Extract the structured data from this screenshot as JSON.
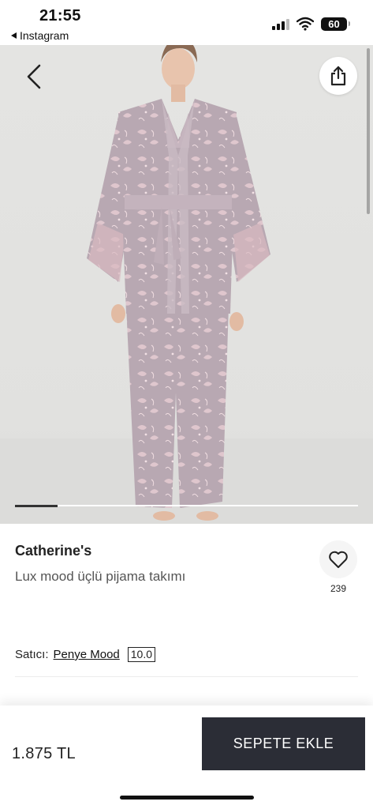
{
  "status_bar": {
    "time": "21:55",
    "back_app": "Instagram",
    "battery": "60",
    "icons": [
      "signal-icon",
      "wifi-icon",
      "battery-icon"
    ]
  },
  "product": {
    "brand": "Catherine's",
    "name": "Lux mood üçlü pijama takımı",
    "favorite_count": "239",
    "image_count_position": {
      "current": 1,
      "indicator_fraction": 0.125
    }
  },
  "seller": {
    "label": "Satıcı:",
    "name": "Penye Mood",
    "score": "10.0"
  },
  "bottom_bar": {
    "price": "1.875 TL",
    "add_to_cart": "SEPETE EKLE"
  },
  "colors": {
    "cart_button": "#2b2d36",
    "garment": "#b9a9b3",
    "print": "#e8c7cf"
  }
}
